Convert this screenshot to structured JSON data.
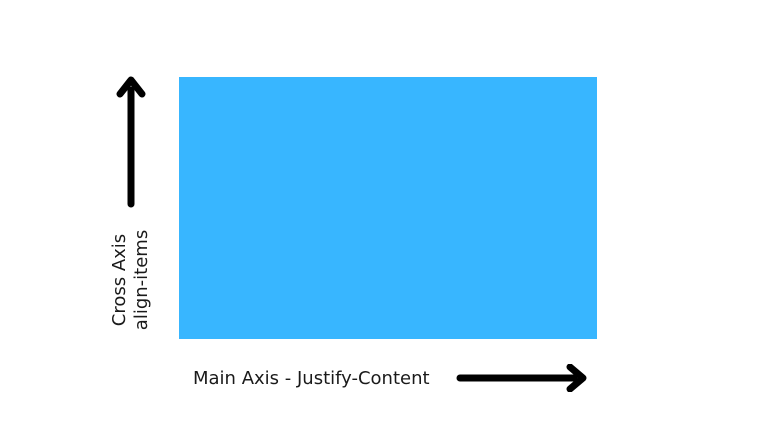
{
  "colors": {
    "container_fill": "#38b6ff",
    "arrow": "#000000",
    "text": "#1a1a1a",
    "background": "#ffffff"
  },
  "cross_axis": {
    "title": "Cross Axis",
    "property": "align-items",
    "arrow_direction": "up"
  },
  "main_axis": {
    "label": "Main Axis - Justify-Content",
    "arrow_direction": "right"
  }
}
